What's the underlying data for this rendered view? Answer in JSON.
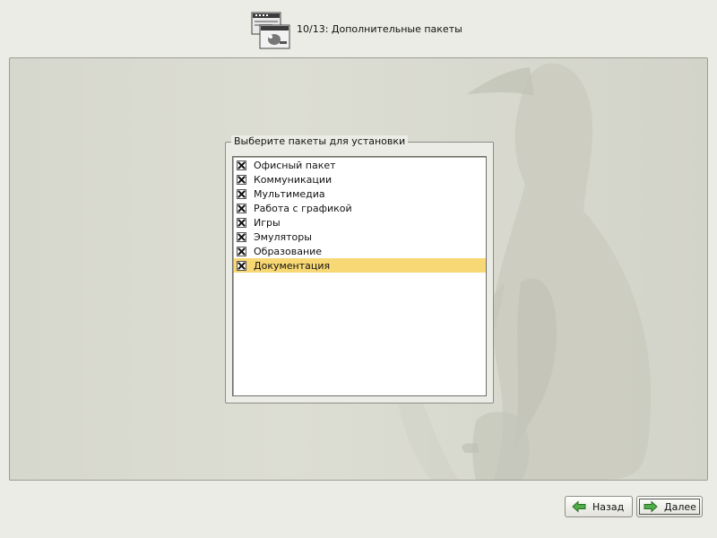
{
  "header": {
    "title": "10/13: Дополнительные пакеты",
    "icon": "installer-stage-icon"
  },
  "group": {
    "legend": "Выберите пакеты для установки",
    "items": [
      {
        "label": "Офисный пакет",
        "checked": true,
        "selected": false
      },
      {
        "label": "Коммуникации",
        "checked": true,
        "selected": false
      },
      {
        "label": "Мультимедиа",
        "checked": true,
        "selected": false
      },
      {
        "label": "Работа с графикой",
        "checked": true,
        "selected": false
      },
      {
        "label": "Игры",
        "checked": true,
        "selected": false
      },
      {
        "label": "Эмуляторы",
        "checked": true,
        "selected": false
      },
      {
        "label": "Образование",
        "checked": true,
        "selected": false
      },
      {
        "label": "Документация",
        "checked": true,
        "selected": true
      }
    ]
  },
  "buttons": {
    "back_label": "Назад",
    "next_label": "Далее"
  },
  "colors": {
    "selection": "#f8d874",
    "arrow_green": "#3f9a3a",
    "panel": "#d8d9cf"
  }
}
